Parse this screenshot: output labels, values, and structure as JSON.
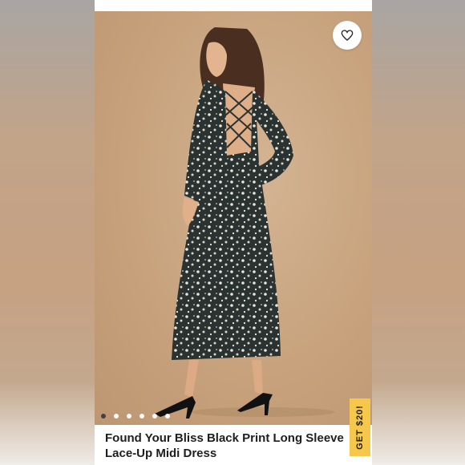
{
  "product": {
    "title_line1": "Found Your Bliss Black Print Long Sleeve",
    "title_line2": "Lace-Up Midi Dress"
  },
  "favorite_icon": "heart-icon",
  "promo": {
    "label": "GET $20!"
  },
  "carousel": {
    "count": 6,
    "active_index": 0
  },
  "colors": {
    "backdrop": "#c7a27d",
    "promo_bg": "#f5c84c",
    "dress": "#2b3232"
  }
}
